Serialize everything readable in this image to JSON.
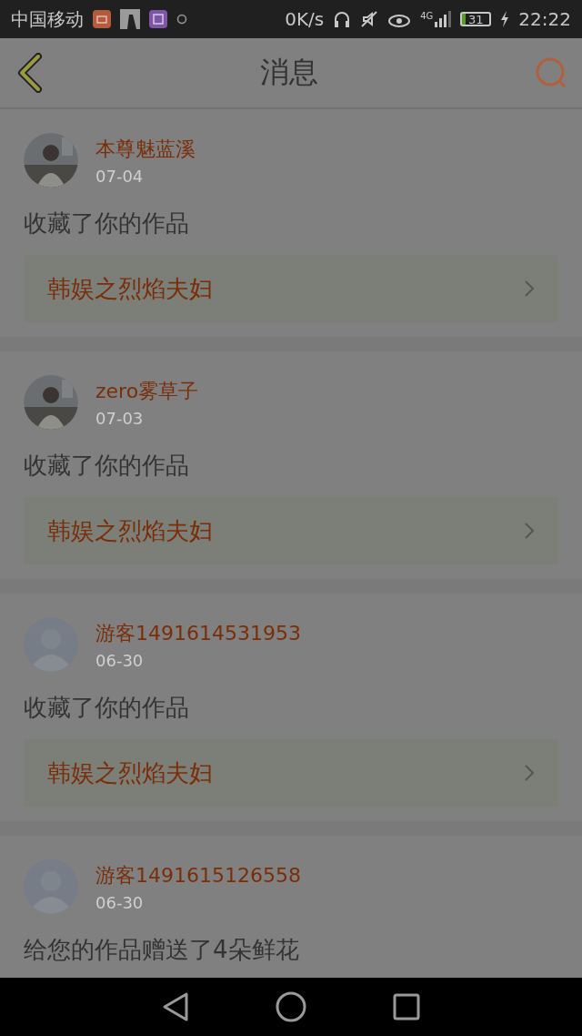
{
  "status_bar": {
    "carrier": "中国移动",
    "speed": "0K/s",
    "network": "4G",
    "battery": "31",
    "time": "22:22"
  },
  "header": {
    "title": "消息"
  },
  "messages": [
    {
      "name": "本尊魅蓝溪",
      "date": "07-04",
      "action": "收藏了你的作品",
      "work": "韩娱之烈焰夫妇"
    },
    {
      "name": "zero雾草子",
      "date": "07-03",
      "action": "收藏了你的作品",
      "work": "韩娱之烈焰夫妇"
    },
    {
      "avatar": {
        "kind": "default"
      },
      "name": "游客1491614531953",
      "date": "06-30",
      "action": "收藏了你的作品",
      "work": "韩娱之烈焰夫妇"
    },
    {
      "avatar": {
        "kind": "default"
      },
      "name": "游客1491615126558",
      "date": "06-30",
      "action": "给您的作品赠送了4朵鲜花"
    }
  ]
}
